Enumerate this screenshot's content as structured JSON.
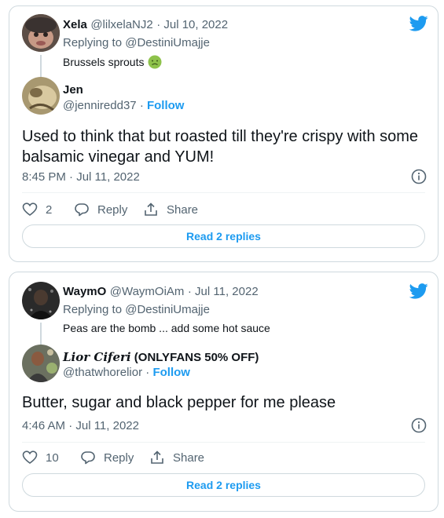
{
  "tweets": [
    {
      "parent": {
        "name": "Xela",
        "handle": "@lilxelaNJ2",
        "date": "· Jul 10, 2022",
        "replying_prefix": "Replying to ",
        "replying_to": "@DestiniUmajje",
        "text": "Brussels sprouts"
      },
      "reply": {
        "name": "Jen",
        "handle": "@jenniredd37",
        "follow": "Follow",
        "text": "Used to think that but roasted till they're crispy with some balsamic vinegar and YUM!",
        "time": "8:45 PM · Jul 11, 2022",
        "likes": "2",
        "reply_label": "Reply",
        "share_label": "Share",
        "read_replies": "Read 2 replies"
      }
    },
    {
      "parent": {
        "name": "WaymO",
        "handle": "@WaymOiAm",
        "date": "· Jul 11, 2022",
        "replying_prefix": "Replying to ",
        "replying_to": "@DestiniUmajje",
        "text": "Peas are the bomb ... add some hot sauce"
      },
      "reply": {
        "name_fancy": "Lior Ciferi",
        "name_rest": " (ONLYFANS 50% OFF)",
        "handle": "@thatwhorelior",
        "follow": "Follow",
        "text": "Butter, sugar and black pepper for me please",
        "time": "4:46 AM · Jul 11, 2022",
        "likes": "10",
        "reply_label": "Reply",
        "share_label": "Share",
        "read_replies": "Read 2 replies"
      }
    }
  ],
  "colors": {
    "accent": "#1d9bf0",
    "muted": "#536471",
    "border": "#cfd9de"
  },
  "icons": [
    "twitter-bird-icon",
    "nauseated-face-emoji",
    "info-icon",
    "heart-icon",
    "reply-bubble-icon",
    "share-icon"
  ]
}
